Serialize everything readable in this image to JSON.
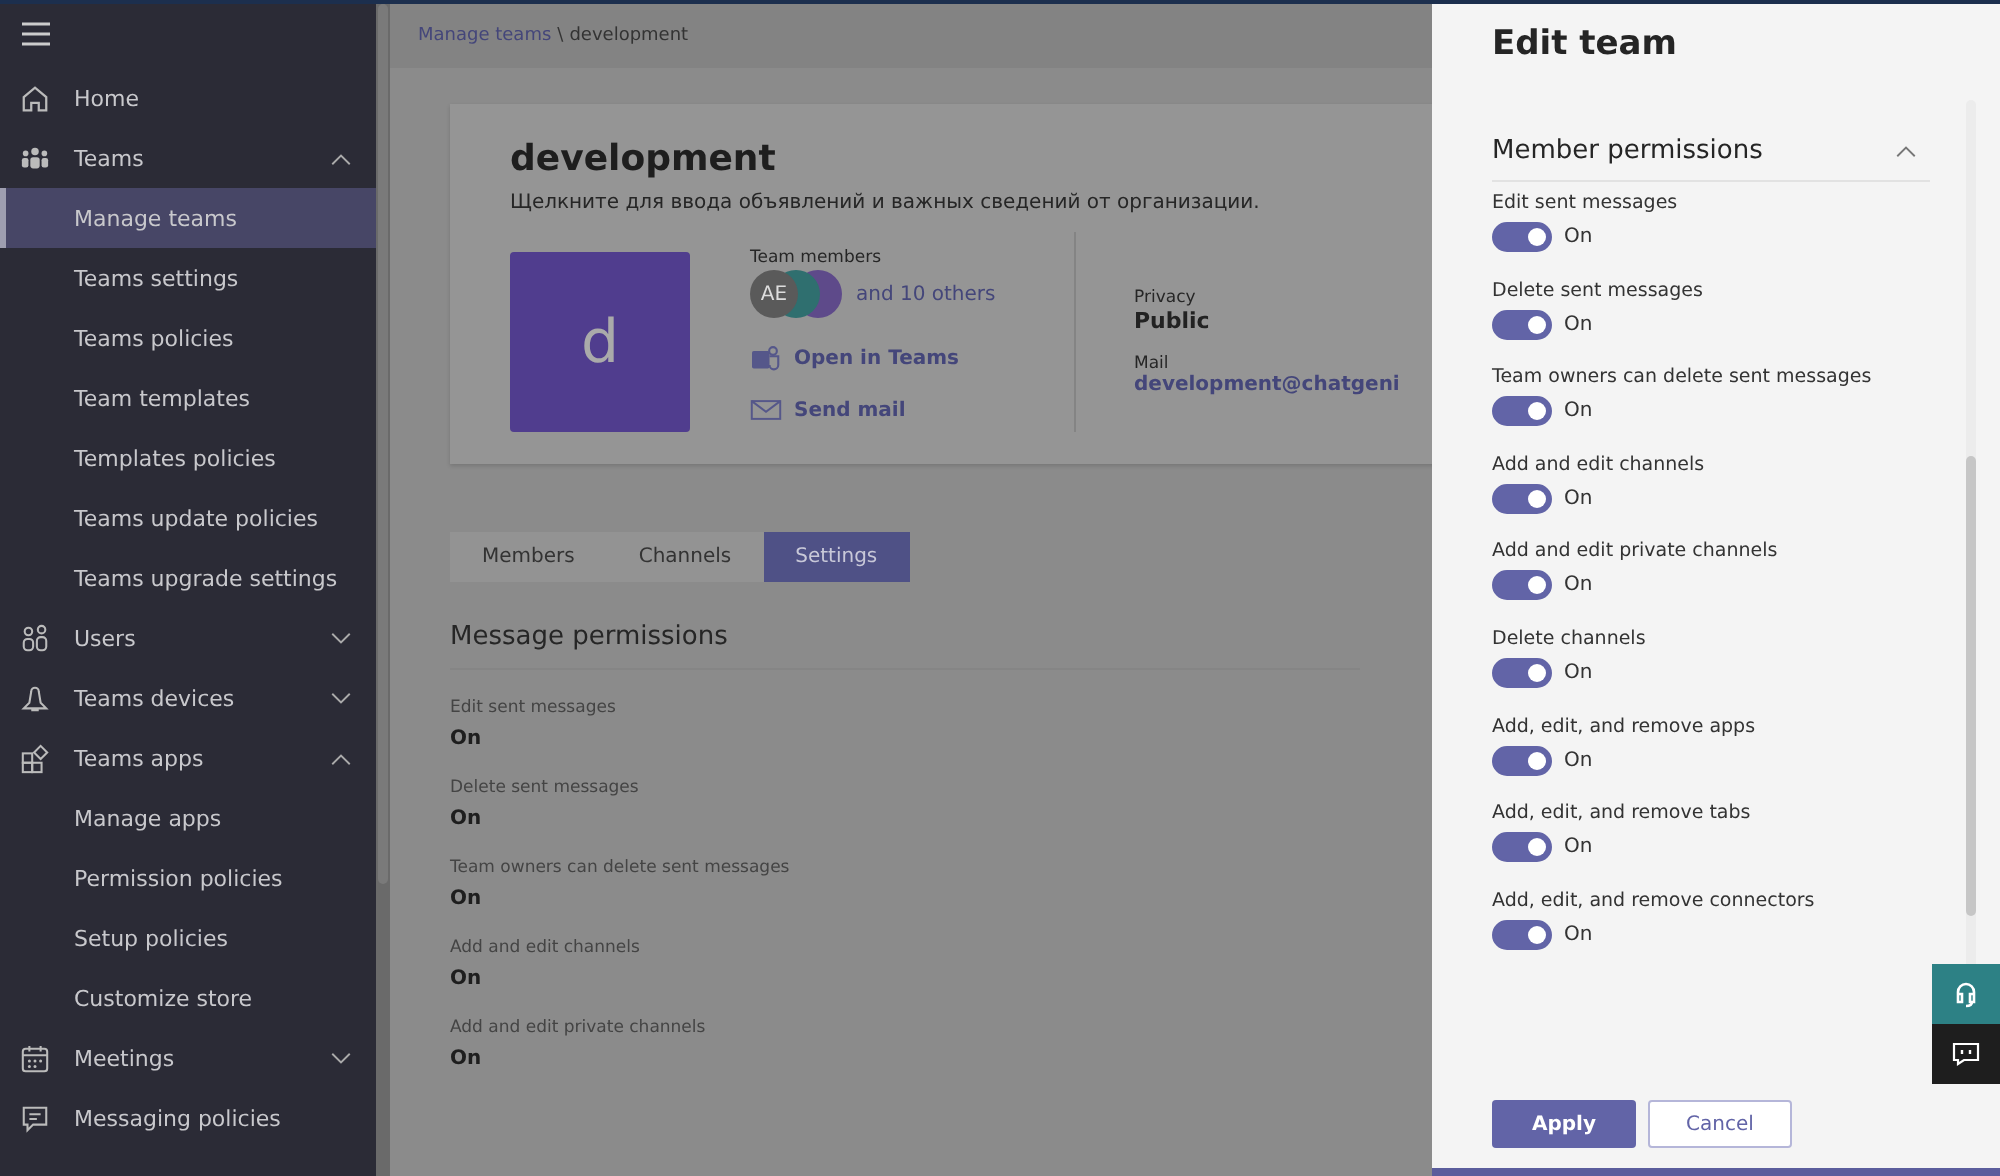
{
  "sidebar": {
    "items": [
      {
        "label": "Home",
        "selected": false
      },
      {
        "label": "Teams",
        "expanded": true,
        "selected": false,
        "children": [
          {
            "label": "Manage teams",
            "selected": true
          },
          {
            "label": "Teams settings",
            "selected": false
          },
          {
            "label": "Teams policies",
            "selected": false
          },
          {
            "label": "Team templates",
            "selected": false
          },
          {
            "label": "Templates policies",
            "selected": false
          },
          {
            "label": "Teams update policies",
            "selected": false
          },
          {
            "label": "Teams upgrade settings",
            "selected": false
          }
        ]
      },
      {
        "label": "Users",
        "expanded": false,
        "selected": false
      },
      {
        "label": "Teams devices",
        "expanded": false,
        "selected": false
      },
      {
        "label": "Teams apps",
        "expanded": true,
        "selected": false,
        "children": [
          {
            "label": "Manage apps",
            "selected": false
          },
          {
            "label": "Permission policies",
            "selected": false
          },
          {
            "label": "Setup policies",
            "selected": false
          },
          {
            "label": "Customize store",
            "selected": false
          }
        ]
      },
      {
        "label": "Meetings",
        "expanded": false,
        "selected": false
      },
      {
        "label": "Messaging policies",
        "selected": false
      }
    ]
  },
  "breadcrumb": {
    "link": "Manage teams",
    "separator": "\\",
    "current": "development"
  },
  "team": {
    "name": "development",
    "description": "Щелкните для ввода объявлений и важных сведений от организации.",
    "avatar_letter": "d",
    "members_label": "Team members",
    "members": [
      {
        "initials": "AE",
        "color": "#5a5a5a"
      },
      {
        "color": "#2f6f6f"
      },
      {
        "color": "#5e4a8a"
      }
    ],
    "others": "and 10 others",
    "open_in_teams": "Open in Teams",
    "send_mail": "Send mail",
    "privacy_label": "Privacy",
    "privacy": "Public",
    "mail_label": "Mail",
    "mail": "development@chatgeni"
  },
  "tabs": [
    {
      "label": "Members",
      "selected": false
    },
    {
      "label": "Channels",
      "selected": false
    },
    {
      "label": "Settings",
      "selected": true
    }
  ],
  "message_permissions": {
    "title": "Message permissions",
    "items": [
      {
        "label": "Edit sent messages",
        "value": "On"
      },
      {
        "label": "Delete sent messages",
        "value": "On"
      },
      {
        "label": "Team owners can delete sent messages",
        "value": "On"
      },
      {
        "label": "Add and edit channels",
        "value": "On"
      },
      {
        "label": "Add and edit private channels",
        "value": "On"
      }
    ]
  },
  "panel": {
    "title": "Edit team",
    "section": {
      "title": "Member permissions",
      "expanded": true,
      "items": [
        {
          "label": "Edit sent messages",
          "on": true,
          "state": "On"
        },
        {
          "label": "Delete sent messages",
          "on": true,
          "state": "On"
        },
        {
          "label": "Team owners can delete sent messages",
          "on": true,
          "state": "On"
        },
        {
          "label": "Add and edit channels",
          "on": true,
          "state": "On"
        },
        {
          "label": "Add and edit private channels",
          "on": true,
          "state": "On"
        },
        {
          "label": "Delete channels",
          "on": true,
          "state": "On"
        },
        {
          "label": "Add, edit, and remove apps",
          "on": true,
          "state": "On"
        },
        {
          "label": "Add, edit, and remove tabs",
          "on": true,
          "state": "On"
        },
        {
          "label": "Add, edit, and remove connectors",
          "on": true,
          "state": "On"
        }
      ]
    },
    "apply": "Apply",
    "cancel": "Cancel"
  }
}
